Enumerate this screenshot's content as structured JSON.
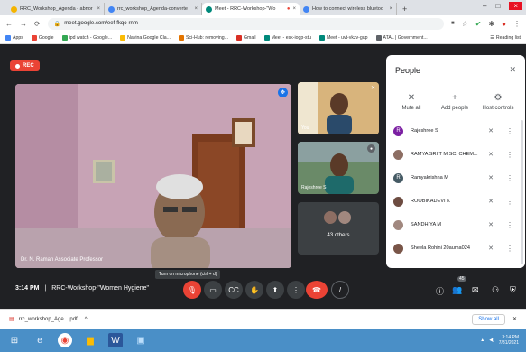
{
  "browser": {
    "tabs": [
      {
        "label": "RRC_Workshop_Agenda - abnor",
        "color": "#f4b400"
      },
      {
        "label": "rrc_workshop_Agenda-converte",
        "color": "#4285f4"
      },
      {
        "label": "Meet - RRC-Workshop-\"Wo",
        "color": "#00897b",
        "active": true
      },
      {
        "label": "How to connect wireless bluetoo",
        "color": "#4285f4"
      }
    ],
    "new_tab": "+",
    "url": "meet.google.com/eef-fkqo-rnm",
    "bookmarks": [
      {
        "label": "Apps",
        "color": "#4285f4"
      },
      {
        "label": "Google",
        "color": "#ea4335"
      },
      {
        "label": "ipd watch - Google...",
        "color": "#34a853"
      },
      {
        "label": "Navina Google Cla...",
        "color": "#fbbc05"
      },
      {
        "label": "Sci-Hub: removing...",
        "color": "#e37400"
      },
      {
        "label": "Gmail",
        "color": "#d93025"
      },
      {
        "label": "Meet - esk-iogp-stu",
        "color": "#00897b"
      },
      {
        "label": "Meet - uvt-vkzv-gup",
        "color": "#00897b"
      },
      {
        "label": "ATAL | Government...",
        "color": "#5f6368"
      }
    ],
    "reading_list": "Reading list"
  },
  "meet": {
    "rec_label": "REC",
    "main_speaker": "Dr. N. Raman Associate Professor",
    "tiles": [
      {
        "label": "You"
      },
      {
        "label": "Rajeshree S"
      },
      {
        "label": "43 others"
      }
    ],
    "panel": {
      "title": "People",
      "actions": [
        {
          "label": "Mute all",
          "icon": "mic-off-icon",
          "glyph": "🎙"
        },
        {
          "label": "Add people",
          "icon": "add-person-icon",
          "glyph": "👤"
        },
        {
          "label": "Host controls",
          "icon": "host-controls-icon",
          "glyph": "⚙"
        }
      ],
      "people": [
        {
          "name": "Rajeshree S",
          "initial": "R",
          "color": "#7b1fa2"
        },
        {
          "name": "RAMYA SRI T M.SC. CHEM...",
          "initial": "",
          "color": "#8d6e63"
        },
        {
          "name": "Ramyakrishna M",
          "initial": "R",
          "color": "#455a64"
        },
        {
          "name": "ROOBIKADEVI K",
          "initial": "",
          "color": "#6d4c41"
        },
        {
          "name": "SANDHIYA M",
          "initial": "",
          "color": "#a1887f"
        },
        {
          "name": "Sheela Rohini 20auma024",
          "initial": "",
          "color": "#795548"
        }
      ]
    },
    "bottom": {
      "time": "3:14 PM",
      "separator": "|",
      "meeting_name": "RRC-Workshop-\"Women Hygiene\"",
      "tooltip": "Turn on microphone (ctrl + d)",
      "people_count": "45"
    }
  },
  "downloads": {
    "file": "rrc_workshop_Age....pdf",
    "show_all": "Show all"
  },
  "taskbar": {
    "time": "3:14 PM",
    "date": "7/31/2021"
  }
}
